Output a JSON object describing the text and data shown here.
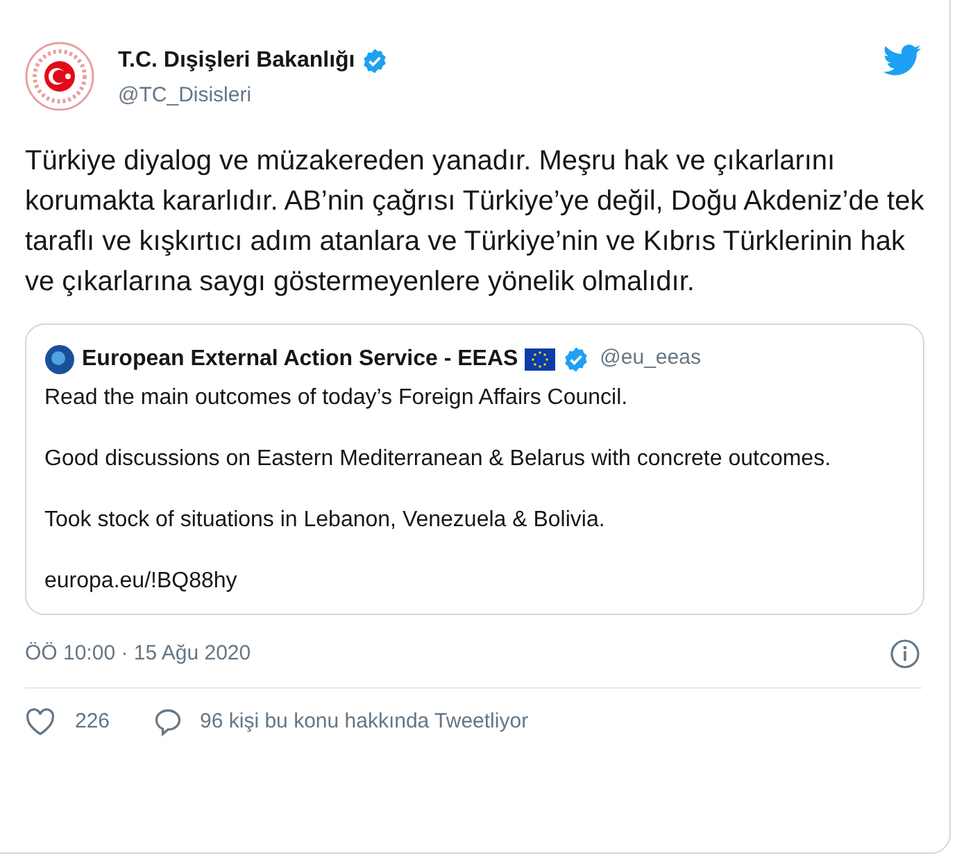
{
  "author": {
    "name": "T.C. Dışişleri Bakanlığı",
    "verified": true,
    "handle": "@TC_Disisleri"
  },
  "text": "Türkiye diyalog ve müzakereden yanadır. Meşru hak ve çıkarlarını korumakta kararlıdır. AB’nin çağrısı Türkiye’ye değil, Doğu Akdeniz’de tek taraflı ve kışkırtıcı adım atanlara ve Türkiye’nin ve Kıbrıs Türklerinin hak ve çıkarlarına saygı göstermeyenlere yönelik olmalıdır.",
  "quoted": {
    "name": "European External Action Service - EEAS",
    "verified": true,
    "handle": "@eu_eeas",
    "paragraphs": [
      "Read the main outcomes of today’s Foreign Affairs Council.",
      "Good discussions on Eastern Mediterranean & Belarus with concrete outcomes.",
      "Took stock of situations in Lebanon, Venezuela & Bolivia.",
      "europa.eu/!BQ88hy"
    ]
  },
  "timestamp": "ÖÖ 10:00 · 15 Ağu 2020",
  "likes": "226",
  "conversation": "96 kişi bu konu hakkında Tweetliyor"
}
